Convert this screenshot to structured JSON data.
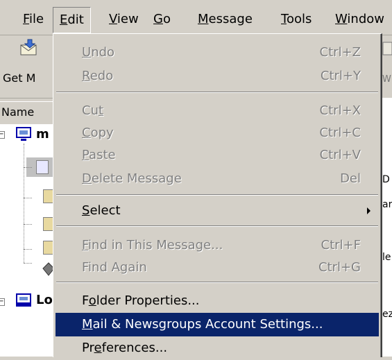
{
  "menubar": {
    "items": [
      {
        "label_pre": "",
        "label_key": "F",
        "label_post": "ile"
      },
      {
        "label_pre": "",
        "label_key": "E",
        "label_post": "dit"
      },
      {
        "label_pre": "",
        "label_key": "V",
        "label_post": "iew"
      },
      {
        "label_pre": "",
        "label_key": "G",
        "label_post": "o"
      },
      {
        "label_pre": "",
        "label_key": "M",
        "label_post": "essage"
      },
      {
        "label_pre": "",
        "label_key": "T",
        "label_post": "ools"
      },
      {
        "label_pre": "",
        "label_key": "W",
        "label_post": "indow"
      }
    ]
  },
  "toolbar": {
    "get_label": "Get M",
    "right_label": "W"
  },
  "folderpane": {
    "column_header": "Name",
    "account1_label": "m",
    "account2_label": "Lo"
  },
  "msgpane": {
    "fragments": [
      "D",
      "ar",
      "le",
      "ez"
    ]
  },
  "edit_menu": {
    "items": [
      {
        "pre": "",
        "key": "U",
        "post": "ndo",
        "accel": "Ctrl+Z",
        "enabled": false
      },
      {
        "pre": "",
        "key": "R",
        "post": "edo",
        "accel": "Ctrl+Y",
        "enabled": false
      },
      {
        "pre": "Cu",
        "key": "t",
        "post": "",
        "accel": "Ctrl+X",
        "enabled": false
      },
      {
        "pre": "",
        "key": "C",
        "post": "opy",
        "accel": "Ctrl+C",
        "enabled": false
      },
      {
        "pre": "",
        "key": "P",
        "post": "aste",
        "accel": "Ctrl+V",
        "enabled": false
      },
      {
        "pre": "",
        "key": "D",
        "post": "elete Message",
        "accel": "Del",
        "enabled": false
      },
      {
        "pre": "",
        "key": "S",
        "post": "elect",
        "accel": "",
        "enabled": true
      },
      {
        "pre": "",
        "key": "F",
        "post": "ind in This Message...",
        "accel": "Ctrl+F",
        "enabled": false
      },
      {
        "pre": "Find A",
        "key": "g",
        "post": "ain",
        "accel": "Ctrl+G",
        "enabled": false
      },
      {
        "pre": "F",
        "key": "o",
        "post": "lder Properties...",
        "accel": "",
        "enabled": true
      },
      {
        "pre": "",
        "key": "M",
        "post": "ail & Newsgroups Account Settings...",
        "accel": "",
        "enabled": true
      },
      {
        "pre": "Pr",
        "key": "e",
        "post": "ferences...",
        "accel": "",
        "enabled": true
      }
    ]
  },
  "colors": {
    "face": "#d4d0c8",
    "highlight": "#0a246a",
    "disabled_text": "#808080"
  },
  "icons": [
    "get-mail-icon",
    "account-icon",
    "folder-icon",
    "local-folders-icon",
    "submenu-arrow-icon"
  ]
}
